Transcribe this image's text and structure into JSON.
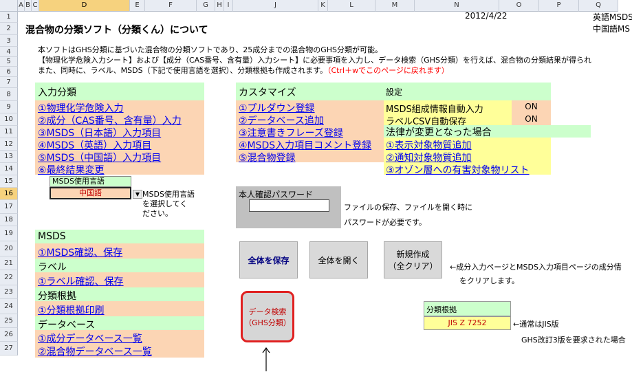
{
  "sheet": {
    "columns": [
      "A",
      "B",
      "C",
      "D",
      "E",
      "F",
      "G",
      "H",
      "I",
      "J",
      "K",
      "L",
      "M",
      "N",
      "O",
      "P",
      "Q"
    ],
    "rows": [
      "1",
      "2",
      "3",
      "4",
      "5",
      "6",
      "7",
      "8",
      "9",
      "10",
      "11",
      "12",
      "13",
      "14",
      "15",
      "16",
      "17",
      "18",
      "19",
      "20",
      "21",
      "22",
      "23",
      "24",
      "25",
      "26",
      "27"
    ],
    "selected_row": "16",
    "selected_column": "D"
  },
  "header": {
    "date": "2012/4/22",
    "lang_en": "英語MSDS",
    "lang_cn": "中国語MS",
    "title": "混合物の分類ソフト（分類くん）について"
  },
  "intro": {
    "line1": "本ソフトはGHS分類に基づいた混合物の分類ソフトであり、25成分までの混合物のGHS分類が可能。",
    "line2": "【物理化学危険入力シート】および【成分（CAS番号、含有量）入力シート】に必要事項を入力し、データ検索（GHS分類）を行えば、混合物の分類結果が得られ",
    "line3": "また、同時に、ラベル、MSDS（下記で使用言語を選択）、分類根拠も作成されます。",
    "line3_red": "（Ctrl＋wでこのページに戻れます）"
  },
  "input_section": {
    "title": "入力分類",
    "items": [
      "①物理化学危険入力",
      "②成分（CAS番号、含有量）入力",
      "③MSDS（日本語）入力項目",
      "④MSDS（英語）入力項目",
      "⑤MSDS（中国語）入力項目",
      "⑥最終結果変更"
    ]
  },
  "language": {
    "label": "MSDS使用言語",
    "value": "中国語",
    "note1": "MSDS使用言語",
    "note2": "を選択してく",
    "note3": "ださい。"
  },
  "customize": {
    "title": "カスタマイズ",
    "items": [
      "①プルダウン登録",
      "②データベース追加",
      "③注意書きフレーズ登録",
      "④MSDS入力項目コメント登録",
      "⑤混合物登録"
    ]
  },
  "settings": {
    "title": "設定",
    "msds_auto_label": "MSDS組成情報自動入力",
    "msds_auto_value": "ON",
    "label_csv_label": "ラベルCSV自動保存",
    "label_csv_value": "ON",
    "law_title": "法律が変更となった場合",
    "law_items": [
      "①表示対象物質追加",
      "②通知対象物質追加",
      "③オゾン層への有害対象物リスト"
    ]
  },
  "password": {
    "label": "本人確認パスワード",
    "value": "",
    "note1": "ファイルの保存、ファイルを開く時に",
    "note2": "パスワードが必要です。"
  },
  "output_section": {
    "msds_title": "MSDS",
    "msds_item": "①MSDS確認、保存",
    "label_title": "ラベル",
    "label_item": "①ラベル確認、保存",
    "basis_title": "分類根拠",
    "basis_item": "①分類根拠印刷",
    "db_title": "データベース",
    "db_items": [
      "①成分データベース一覧",
      "②混合物データベース一覧"
    ]
  },
  "buttons": {
    "save_all": "全体を保存",
    "open_all": "全体を開く",
    "new_line1": "新規作成",
    "new_line2": "（全クリア）",
    "search_line1": "データ検索",
    "search_line2": "（GHS分類）"
  },
  "notes": {
    "clear_note1": "←成分入力ページとMSDS入力項目ページの成分情",
    "clear_note2": "をクリアします。",
    "basis_label": "分類根拠",
    "basis_value": "JIS Z 7252",
    "basis_note": "←通常はJIS版",
    "ghs_note": "GHS改訂3版を要求された場合"
  },
  "colors": {
    "green": "#ccffcc",
    "orange": "#fcd5b4",
    "yellow": "#ffff99",
    "link": "#0000ee",
    "red": "#ff0000",
    "search_border": "#e02020"
  }
}
